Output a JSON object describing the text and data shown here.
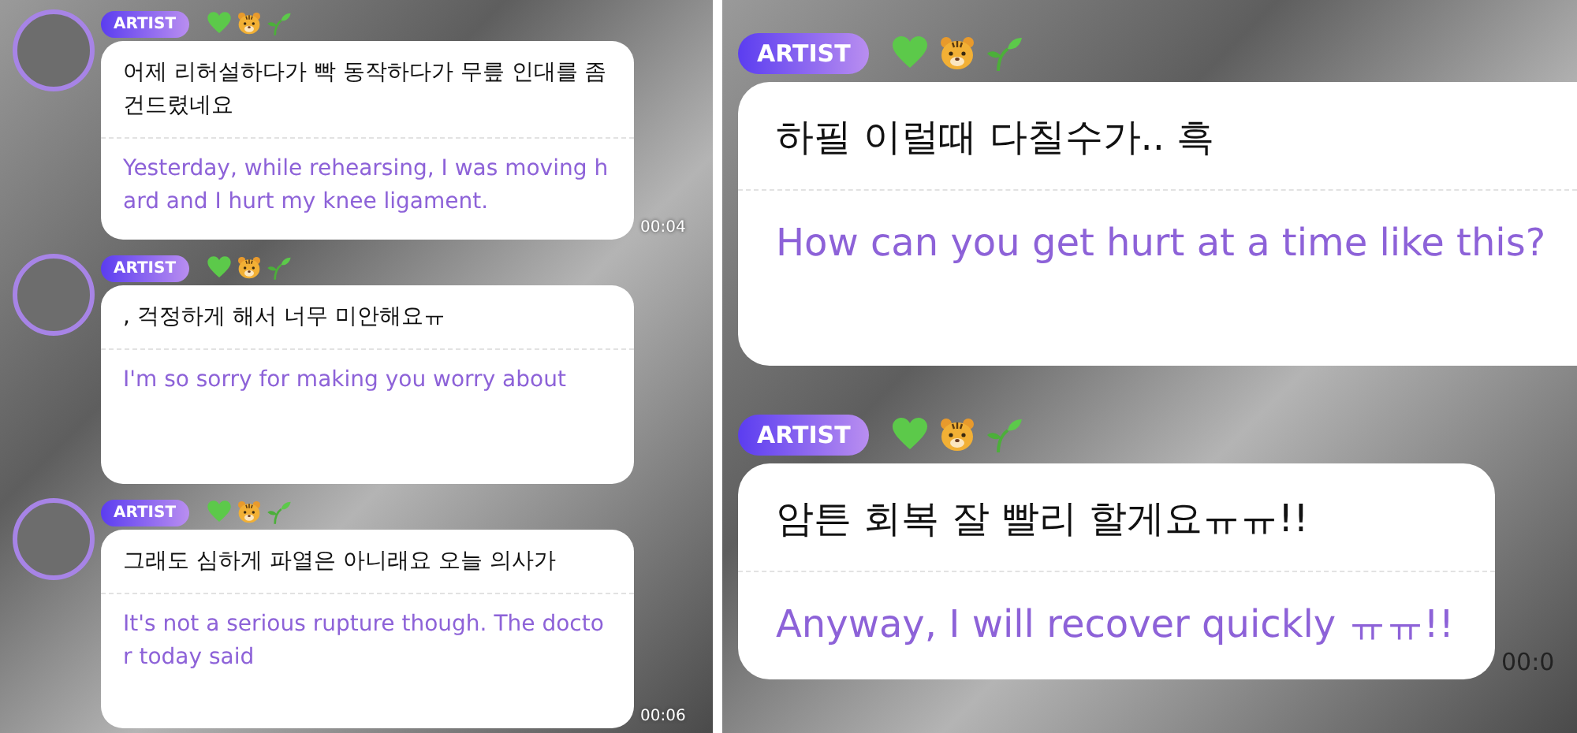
{
  "panels": [
    {
      "messages": [
        {
          "has_avatar": true,
          "badge": "ARTIST",
          "emojis": [
            {
              "kind": "green-heart"
            },
            {
              "kind": "tiger"
            },
            {
              "kind": "seedling"
            }
          ],
          "korean": "어제 리허설하다가 빡 동작하다가 무릎 인대를 좀 건드렸네요",
          "english": "Yesterday, while rehearsing, I was moving hard and I hurt my knee ligament.",
          "time": "00:04"
        },
        {
          "has_avatar": true,
          "badge": "ARTIST",
          "emojis": [
            {
              "kind": "green-heart"
            },
            {
              "kind": "tiger"
            },
            {
              "kind": "seedling"
            }
          ],
          "korean": ", 걱정하게 해서 너무 미안해요ㅠ",
          "english": "I'm so sorry for making you worry about"
        },
        {
          "has_avatar": true,
          "badge": "ARTIST",
          "emojis": [
            {
              "kind": "green-heart"
            },
            {
              "kind": "tiger"
            },
            {
              "kind": "seedling"
            }
          ],
          "korean": "그래도 심하게 파열은 아니래요 오늘 의사가",
          "english": "It's not a serious rupture though. The doctor today said",
          "time": "00:06"
        }
      ]
    },
    {
      "messages": [
        {
          "has_avatar": false,
          "badge": "ARTIST",
          "emojis": [
            {
              "kind": "green-heart"
            },
            {
              "kind": "tiger"
            },
            {
              "kind": "seedling"
            }
          ],
          "korean": "하필 이럴때 다칠수가.. 흑",
          "english": "How can you get hurt at a time like this?"
        },
        {
          "has_avatar": false,
          "badge": "ARTIST",
          "emojis": [
            {
              "kind": "green-heart"
            },
            {
              "kind": "tiger"
            },
            {
              "kind": "seedling"
            }
          ],
          "korean": "암튼 회복 잘 빨리 할게요ㅠㅠ!!",
          "english": "Anyway, I will recover quickly ㅠㅠ!!",
          "time": "00:0"
        }
      ]
    }
  ]
}
